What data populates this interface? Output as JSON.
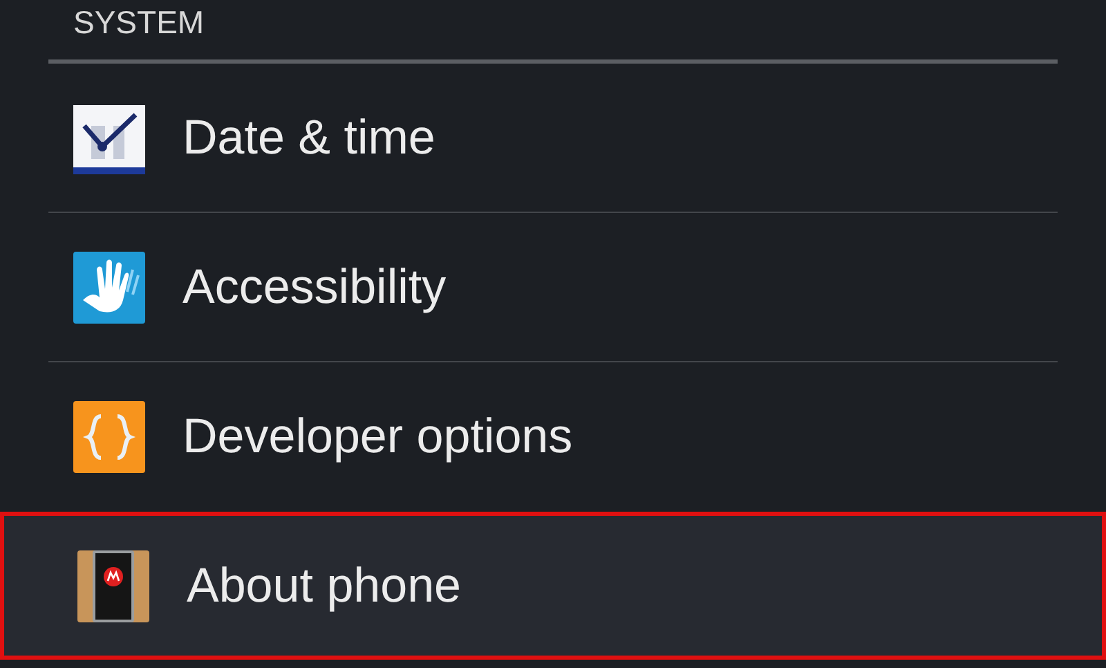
{
  "section": {
    "title": "SYSTEM"
  },
  "items": [
    {
      "label": "Date & time",
      "kind": "calendar",
      "selected": false
    },
    {
      "label": "Accessibility",
      "kind": "hand",
      "selected": false
    },
    {
      "label": "Developer options",
      "kind": "braces",
      "selected": false
    },
    {
      "label": "About phone",
      "kind": "phone",
      "selected": true
    }
  ]
}
